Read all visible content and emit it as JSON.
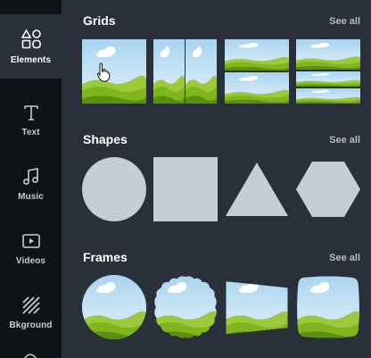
{
  "sidebar": {
    "items": [
      {
        "label": "Elements",
        "icon": "shapes-icon"
      },
      {
        "label": "Text",
        "icon": "text-icon"
      },
      {
        "label": "Music",
        "icon": "music-note-icon"
      },
      {
        "label": "Videos",
        "icon": "video-play-icon"
      },
      {
        "label": "Bkground",
        "icon": "background-hatch-icon"
      }
    ]
  },
  "sections": {
    "grids": {
      "title": "Grids",
      "see_all": "See all"
    },
    "shapes": {
      "title": "Shapes",
      "see_all": "See all"
    },
    "frames": {
      "title": "Frames",
      "see_all": "See all"
    }
  },
  "colors": {
    "sidebar_bg": "#0e1318",
    "panel_bg": "#293039",
    "shape_fill": "#c6cdd5",
    "sky": "#bfe0f3",
    "grass": "#7fb51d",
    "grass_dark": "#5a8f12"
  }
}
